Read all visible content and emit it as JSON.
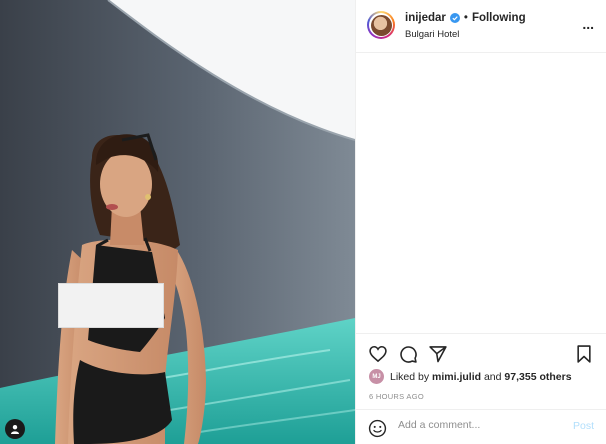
{
  "post": {
    "username": "inijedar",
    "verified": true,
    "separator": "•",
    "follow_state": "Following",
    "location": "Bulgari Hotel",
    "more_label": "..."
  },
  "actions": {
    "icons": [
      "heart-icon",
      "comment-icon",
      "share-icon",
      "bookmark-icon"
    ],
    "liked_by_prefix": "Liked by",
    "liked_by_user": "mimi.julid",
    "and_text": "and",
    "others_count": "97,355 others",
    "timestamp": "6 HOURS AGO"
  },
  "comment_box": {
    "placeholder": "Add a comment...",
    "post_label": "Post"
  },
  "colors": {
    "accent_disabled": "#b2dffc",
    "verified_blue": "#3897f0",
    "water": "#3fc1b8"
  }
}
